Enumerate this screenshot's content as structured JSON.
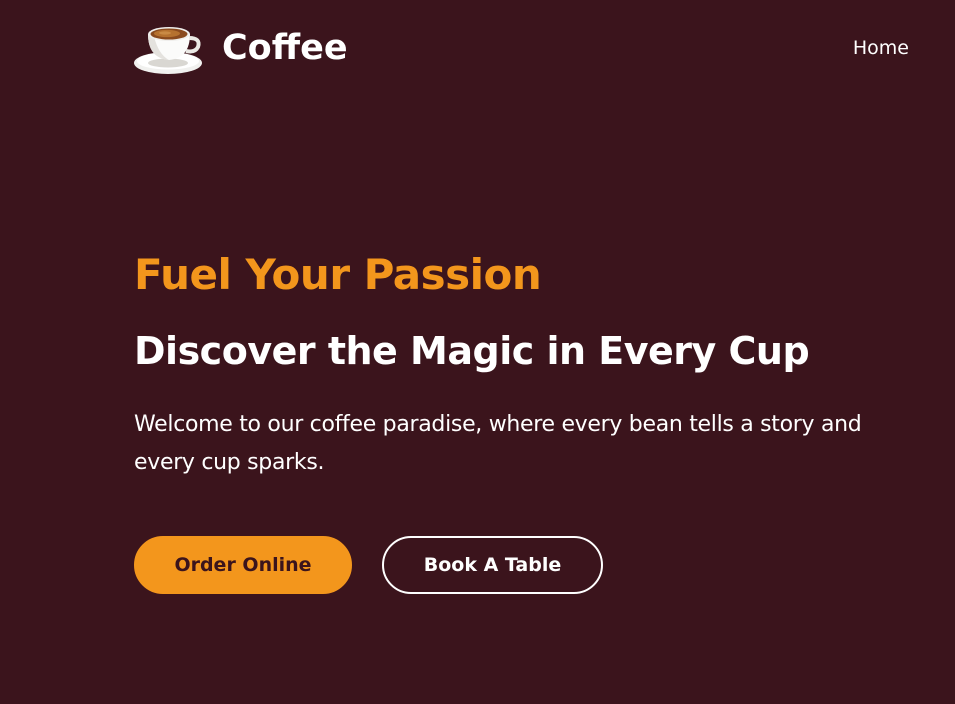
{
  "navbar": {
    "brand_name": "Coffee",
    "logo_icon": "coffee-cup-icon",
    "links": [
      {
        "label": "Home"
      }
    ]
  },
  "hero": {
    "subtitle": "Fuel Your Passion",
    "title": "Discover the Magic in Every Cup",
    "description": "Welcome to our coffee paradise, where every bean tells a story and every cup sparks.",
    "buttons": {
      "order_label": "Order Online",
      "book_label": "Book A Table"
    }
  },
  "colors": {
    "background": "#3b141c",
    "accent": "#f3961c",
    "text": "#ffffff"
  }
}
